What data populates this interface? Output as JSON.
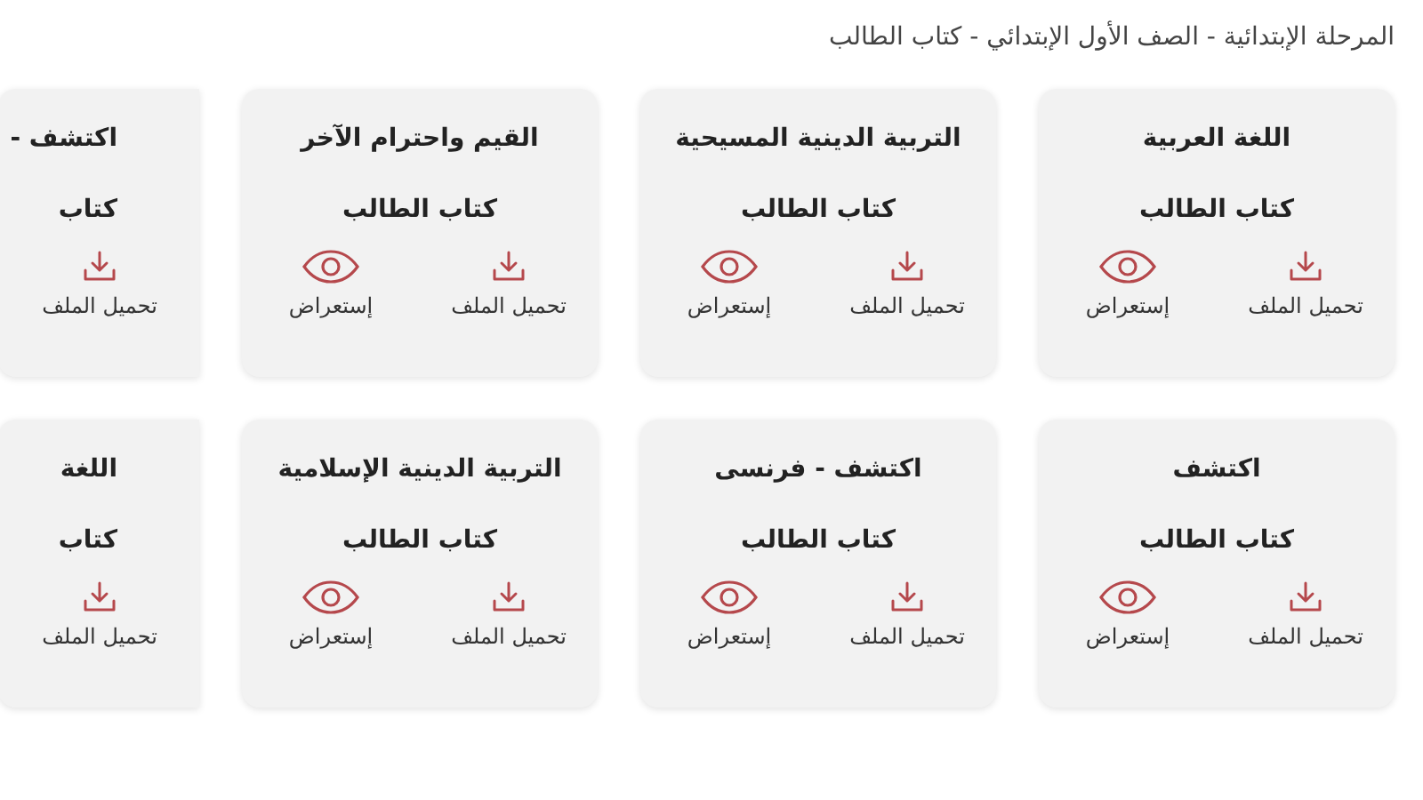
{
  "breadcrumb": "المرحلة الإبتدائية - الصف الأول الإبتدائي - كتاب الطالب",
  "rows": [
    {
      "cards": [
        {
          "kind": "full",
          "title": "اللغة العربية",
          "subtitle": "كتاب الطالب",
          "actions": [
            {
              "kind": "download",
              "label": "تحميل الملف"
            },
            {
              "kind": "view",
              "label": "إستعراض"
            }
          ]
        },
        {
          "kind": "full",
          "title": "التربية الدينية المسيحية",
          "subtitle": "كتاب الطالب",
          "actions": [
            {
              "kind": "download",
              "label": "تحميل الملف"
            },
            {
              "kind": "view",
              "label": "إستعراض"
            }
          ]
        },
        {
          "kind": "full",
          "title": "القيم واحترام الآخر",
          "subtitle": "كتاب الطالب",
          "actions": [
            {
              "kind": "download",
              "label": "تحميل الملف"
            },
            {
              "kind": "view",
              "label": "إستعراض"
            }
          ]
        },
        {
          "kind": "partial",
          "title": "اكتشف -",
          "subtitle": "كتاب",
          "actions": [
            {
              "kind": "download",
              "label": "تحميل الملف"
            }
          ]
        }
      ]
    },
    {
      "cards": [
        {
          "kind": "full",
          "title": "اكتشف",
          "subtitle": "كتاب الطالب",
          "actions": [
            {
              "kind": "download",
              "label": "تحميل الملف"
            },
            {
              "kind": "view",
              "label": "إستعراض"
            }
          ]
        },
        {
          "kind": "full",
          "title": "اكتشف - فرنسى",
          "subtitle": "كتاب الطالب",
          "actions": [
            {
              "kind": "download",
              "label": "تحميل الملف"
            },
            {
              "kind": "view",
              "label": "إستعراض"
            }
          ]
        },
        {
          "kind": "full",
          "title": "التربية الدينية الإسلامية",
          "subtitle": "كتاب الطالب",
          "actions": [
            {
              "kind": "download",
              "label": "تحميل الملف"
            },
            {
              "kind": "view",
              "label": "إستعراض"
            }
          ]
        },
        {
          "kind": "partial",
          "title": "اللغة",
          "subtitle": "كتاب",
          "actions": [
            {
              "kind": "download",
              "label": "تحميل الملف"
            }
          ]
        }
      ]
    }
  ]
}
